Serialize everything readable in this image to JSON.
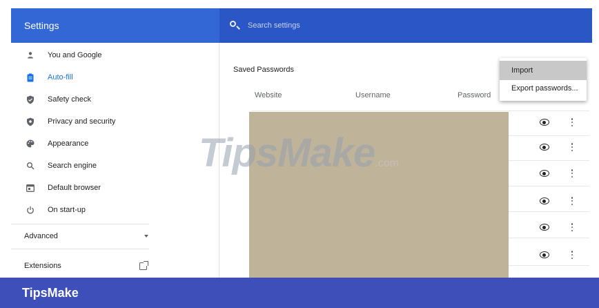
{
  "app": {
    "title": "Settings"
  },
  "search": {
    "placeholder": "Search settings"
  },
  "sidebar": {
    "items": [
      {
        "label": "You and Google",
        "icon": "person-icon"
      },
      {
        "label": "Auto-fill",
        "icon": "clipboard-icon",
        "active": true
      },
      {
        "label": "Safety check",
        "icon": "shield-icon"
      },
      {
        "label": "Privacy and security",
        "icon": "shield-lock-icon"
      },
      {
        "label": "Appearance",
        "icon": "palette-icon"
      },
      {
        "label": "Search engine",
        "icon": "search-icon"
      },
      {
        "label": "Default browser",
        "icon": "browser-icon"
      },
      {
        "label": "On start-up",
        "icon": "power-icon"
      }
    ],
    "advanced_label": "Advanced",
    "extensions_label": "Extensions"
  },
  "main": {
    "section_title": "Saved Passwords",
    "columns": [
      "Website",
      "Username",
      "Password"
    ]
  },
  "menu": {
    "items": [
      "Import",
      "Export passwords..."
    ]
  },
  "watermark": {
    "text": "TipsMake",
    "suffix": ".com"
  },
  "footer": {
    "brand": "TipsMake"
  },
  "colors": {
    "header": "#3367d6",
    "accent": "#1a73e8",
    "footer": "#3e4fb9",
    "redacted_block": "#bfb39a"
  }
}
